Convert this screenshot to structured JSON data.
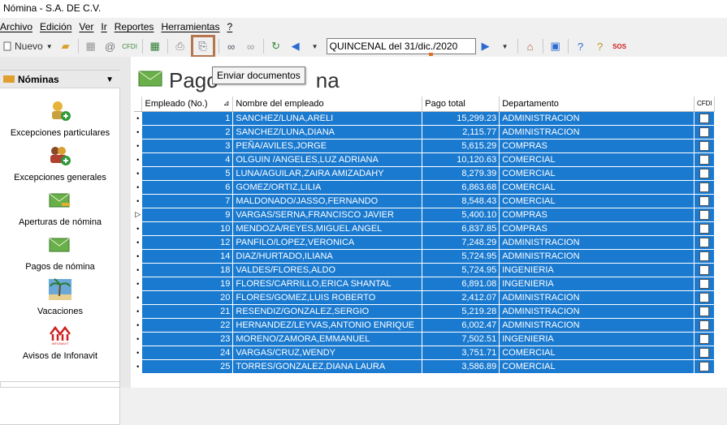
{
  "window": {
    "title": "Nómina -              S.A. DE C.V."
  },
  "menu": [
    "Archivo",
    "Edición",
    "Ver",
    "Ir",
    "Reportes",
    "Herramientas",
    "?"
  ],
  "toolbar": {
    "new_label": "Nuevo",
    "cfdi_label": "CFDI",
    "sos_label": "SOS",
    "period": "QUINCENAL del 31/dic./2020"
  },
  "sidebar": {
    "header": "Nóminas",
    "items": [
      {
        "label": "Excepciones particulares",
        "icon": "employee-add-icon"
      },
      {
        "label": "Excepciones generales",
        "icon": "group-add-icon"
      },
      {
        "label": "Aperturas de nómina",
        "icon": "envelope-key-icon"
      },
      {
        "label": "Pagos de nómina",
        "icon": "envelope-money-icon"
      },
      {
        "label": "Vacaciones",
        "icon": "palm-tree-icon"
      },
      {
        "label": "Avisos de Infonavit",
        "icon": "infonavit-logo-icon",
        "logo_text": "INFONAVIT"
      }
    ]
  },
  "main": {
    "title": "Pago",
    "title_tail": "na",
    "tooltip": "Enviar documentos"
  },
  "grid": {
    "columns": [
      "Empleado (No.)",
      "Nombre del empleado",
      "Pago total",
      "Departamento",
      "CFDI"
    ],
    "rows": [
      [
        "1",
        "SANCHEZ/LUNA,ARELI",
        "15,299.23",
        "ADMINISTRACION"
      ],
      [
        "2",
        "SANCHEZ/LUNA,DIANA",
        "2,115.77",
        "ADMINISTRACION"
      ],
      [
        "3",
        "PEÑA/AVILES,JORGE",
        "5,615.29",
        "COMPRAS"
      ],
      [
        "4",
        "OLGUIN /ANGELES,LUZ ADRIANA",
        "10,120.63",
        "COMERCIAL"
      ],
      [
        "5",
        "LUNA/AGUILAR,ZAIRA AMIZADAHY",
        "8,279.39",
        "COMERCIAL"
      ],
      [
        "6",
        "GOMEZ/ORTIZ,LILIA",
        "6,863.68",
        "COMERCIAL"
      ],
      [
        "7",
        "MALDONADO/JASSO,FERNANDO",
        "8,548.43",
        "COMERCIAL"
      ],
      [
        "9",
        "VARGAS/SERNA,FRANCISCO JAVIER",
        "5,400.10",
        "COMPRAS"
      ],
      [
        "10",
        "MENDOZA/REYES,MIGUEL ANGEL",
        "6,837.85",
        "COMPRAS"
      ],
      [
        "12",
        "PANFILO/LOPEZ,VERONICA",
        "7,248.29",
        "ADMINISTRACION"
      ],
      [
        "14",
        "DIAZ/HURTADO,ILIANA",
        "5,724.95",
        "ADMINISTRACION"
      ],
      [
        "18",
        "VALDES/FLORES,ALDO",
        "5,724.95",
        "INGENIERIA"
      ],
      [
        "19",
        "FLORES/CARRILLO,ERICA SHANTAL",
        "6,891.08",
        "INGENIERIA"
      ],
      [
        "20",
        "FLORES/GOMEZ,LUIS ROBERTO",
        "2,412.07",
        "ADMINISTRACION"
      ],
      [
        "21",
        "RESENDIZ/GONZALEZ,SERGIO",
        "5,219.28",
        "ADMINISTRACION"
      ],
      [
        "22",
        "HERNANDEZ/LEYVAS,ANTONIO ENRIQUE",
        "6,002.47",
        "ADMINISTRACION"
      ],
      [
        "23",
        "MORENO/ZAMORA,EMMANUEL",
        "7,502.51",
        "INGENIERIA"
      ],
      [
        "24",
        "VARGAS/CRUZ,WENDY",
        "3,751.71",
        "COMERCIAL"
      ],
      [
        "25",
        "TORRES/GONZALEZ,DIANA LAURA",
        "3,586.89",
        "COMERCIAL"
      ]
    ]
  },
  "colors": {
    "selection": "#1a7ad0",
    "highlight_border": "#b5764e"
  }
}
